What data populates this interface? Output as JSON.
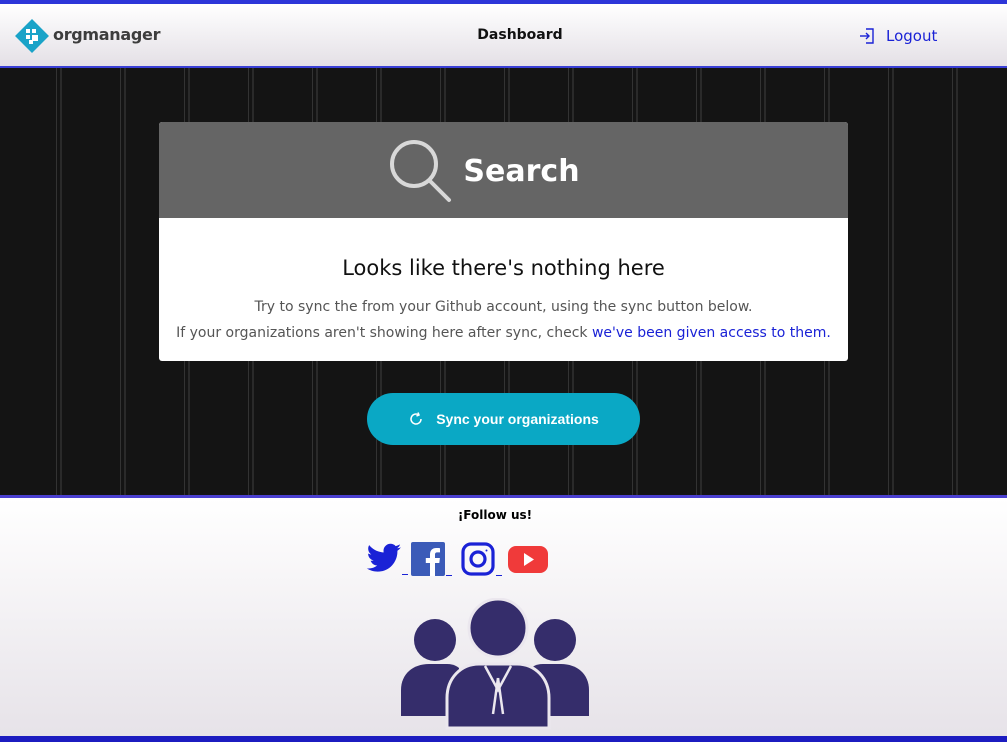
{
  "brand": {
    "name": "orgmanager"
  },
  "header": {
    "title": "Dashboard",
    "logout_label": "Logout"
  },
  "search_card": {
    "title": "Search",
    "heading": "Looks like there's nothing here",
    "line1": "Try to sync the from your Github account, using the sync button below.",
    "line2_prefix": "If your organizations aren't showing here after sync, check ",
    "line2_link": "we've been given access to them."
  },
  "sync_button": {
    "label": "Sync your organizations"
  },
  "footer": {
    "follow_label": "¡Follow us!",
    "social": [
      {
        "icon": "twitter-icon",
        "color": "#1a22d6"
      },
      {
        "icon": "facebook-icon",
        "color": "#3b5bb8"
      },
      {
        "icon": "instagram-icon",
        "color": "#1a22d6"
      },
      {
        "icon": "youtube-icon",
        "color": "#f03a3a"
      }
    ]
  },
  "colors": {
    "accent": "#0aa8c5",
    "link": "#1a22d6",
    "people_icon": "#352d6b",
    "card_header": "#656565"
  }
}
